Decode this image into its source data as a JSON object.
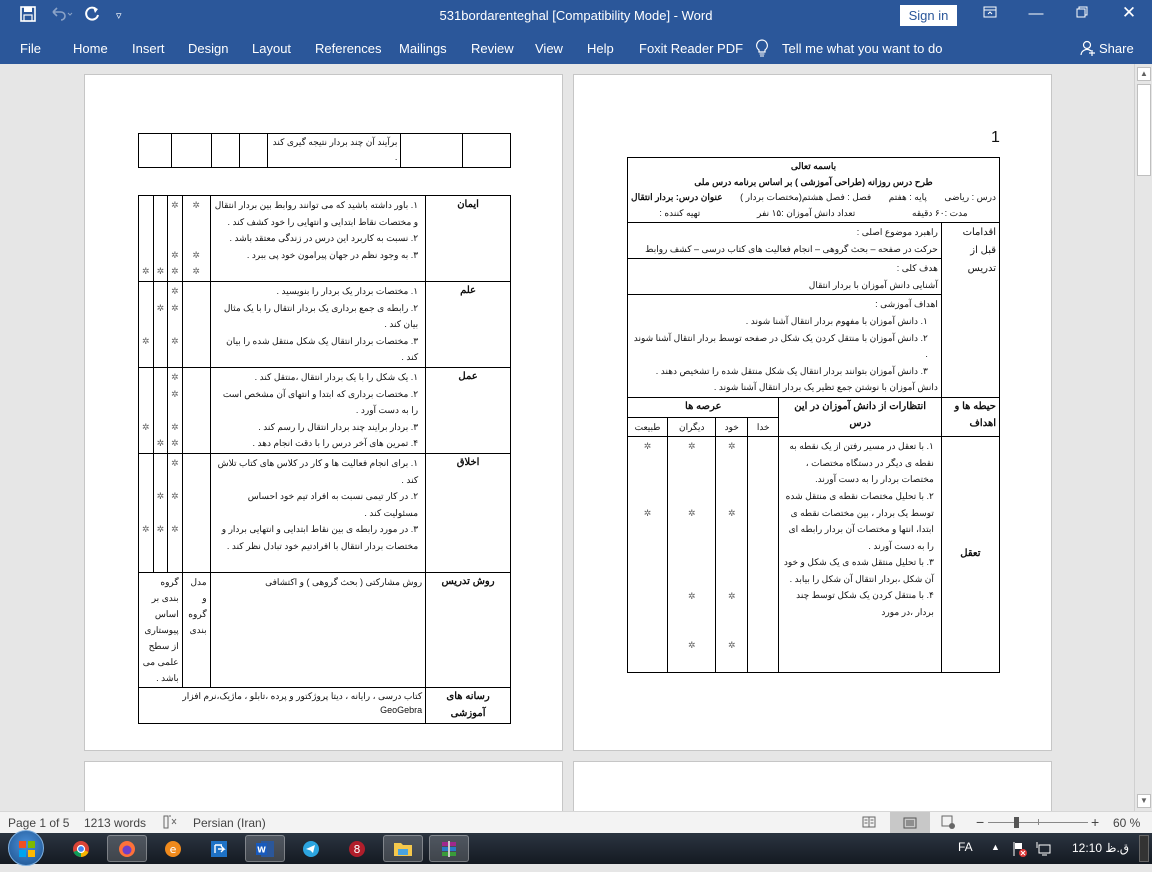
{
  "window": {
    "title": "531bordarenteghal [Compatibility Mode]  -  Word",
    "sign_in": "Sign in",
    "qat": {
      "save": "save-icon",
      "undo": "undo-icon",
      "redo": "redo-icon",
      "customize": "customize-qat-icon"
    }
  },
  "ribbon": {
    "tabs": [
      "File",
      "Home",
      "Insert",
      "Design",
      "Layout",
      "References",
      "Mailings",
      "Review",
      "View",
      "Help",
      "Foxit Reader PDF"
    ],
    "tell_me": "Tell me what you want to do",
    "share": "Share"
  },
  "page1": {
    "page_number": "1",
    "header": {
      "line1": "باسمه تعالی",
      "line2": "طرح درس روزانه (طراحی آموزشی ) بر اساس برنامه درس ملی",
      "subject": "درس : ریاضی",
      "grade": "پایه : هفتم",
      "chapter": "فصل : فصل هشتم(مختصات بردار )",
      "lesson": "عنوان درس: بردار انتقال",
      "duration": "مدت :۶۰ دقیقه",
      "students": "تعداد دانش آموزان :۱۵ نفر",
      "author": "تهیه کننده :"
    },
    "pre_teaching": {
      "label": "اقدامات قبل از تدریس",
      "strategy_title": "راهبرد موضوع اصلی :",
      "strategy_text": "حرکت در صفحه – بحث گروهی – انجام فعالیت های کتاب درسی – کشف روابط",
      "general_goal_title": "هدف کلی :",
      "general_goal_text": "آشنایی دانش آموزان با بردار انتقال",
      "objectives_title": "اهداف آموزشی :",
      "objectives": [
        "۱.  دانش آموزان با مفهوم بردار انتقال آشنا شوند .",
        "۲.  دانش آموزان با منتقل کردن یک شکل در صفحه توسط بردار انتقال آشنا شوند .",
        "۳.  دانش آموزان بتوانند بردار انتقال یک شکل منتقل شده را تشخیص دهند ."
      ],
      "objective_extra": "دانش آموزان با نوشتن جمع تظیر یک بردار انتقال آشنا شوند ."
    },
    "columns": {
      "domain": "حیطه ها و اهداف",
      "expectations": "انتظارات از دانش آموزان در این درس",
      "arenas": "عرصه ها",
      "god": "خدا",
      "self": "خود",
      "others": "دیگران",
      "nature": "طبیعت"
    },
    "reasoning": {
      "label": "تعقل",
      "items": [
        "۱.  با تعقل در مسیر رفتن از یک نقطه به نقطه ی دیگر در دستگاه مختصات ، مختصات بردار را به دست آورند.",
        "۲.  با تحلیل مختصات نقطه ی منتقل شده توسط یک بردار ، بین مختصات نقطه ی ابتدا، انتها و مختصات آن بردار رابطه ای را به دست آورند .",
        "۳.  با تحلیل منتقل شده ی یک شکل و خود آن شکل ،بردار انتقال آن شکل را بیابد .",
        "۴.  با منتقل کردن یک شکل توسط چند بردار ،در مورد"
      ],
      "marks": [
        {
          "god": "",
          "self": "*",
          "others": "*",
          "nature": "*"
        },
        {
          "god": "",
          "self": "*",
          "others": "*",
          "nature": "*"
        },
        {
          "god": "",
          "self": "*",
          "others": "*",
          "nature": ""
        },
        {
          "god": "",
          "self": "*",
          "others": "*",
          "nature": ""
        }
      ]
    }
  },
  "page2": {
    "continuation": {
      "text": "برآیند آن چند بردار نتیجه گیری کند ."
    },
    "rows": [
      {
        "label": "ایمان",
        "items": [
          "۱.  باور داشته باشید که می توانند روابط بین بردار انتقال و مختصات نقاط ابتدایی و انتهایی را خود کشف کند .",
          "۲.  نسبت به کاربرد این درس در زندگی معتقد باشد .",
          "۳.  به وجود نظم در جهان پیرامون خود پی ببرد ."
        ],
        "marks": [
          {
            "god": "*",
            "self": "*",
            "others": "",
            "nature": ""
          },
          {
            "god": "*",
            "self": "*",
            "others": "",
            "nature": ""
          },
          {
            "god": "*",
            "self": "*",
            "others": "*",
            "nature": "*"
          }
        ]
      },
      {
        "label": "علم",
        "items": [
          "۱.  مختصات بردار یک بردار را بنویسید .",
          "۲.  رابطه ی جمع برداری یک بردار انتقال را با یک مثال بیان کند .",
          "۳.  مختصات بردار انتقال یک شکل منتقل شده را بیان کند ."
        ],
        "marks": [
          {
            "god": "",
            "self": "*",
            "others": "",
            "nature": ""
          },
          {
            "god": "",
            "self": "*",
            "others": "*",
            "nature": ""
          },
          {
            "god": "",
            "self": "*",
            "others": "",
            "nature": "*"
          }
        ]
      },
      {
        "label": "عمل",
        "items": [
          "۱.  یک شکل را با یک بردار انتقال ،منتقل کند .",
          "۲.  مختصات برداری که ابتدا و انتهای آن مشخص است را به دست آورد .",
          "۳.  بردار برایند چند بردار انتقال را رسم کند .",
          "۴.  تمرین های آخر درس را با دقت انجام دهد ."
        ],
        "marks": [
          {
            "god": "",
            "self": "*",
            "others": "",
            "nature": ""
          },
          {
            "god": "",
            "self": "*",
            "others": "",
            "nature": ""
          },
          {
            "god": "",
            "self": "*",
            "others": "",
            "nature": "*"
          },
          {
            "god": "",
            "self": "*",
            "others": "*",
            "nature": ""
          }
        ]
      },
      {
        "label": "اخلاق",
        "items": [
          "۱.  برای انجام فعالیت ها و کار در کلاس های کتاب تلاش کند .",
          "۲.  در کار تیمی نسبت به افراد تیم خود احساس مسئولیت کند .",
          "۳.  در مورد رابطه ی بین نقاط ابتدایی و انتهایی بردار و مختصات بردار انتقال با افرادتیم خود تبادل نظر کند ."
        ],
        "marks": [
          {
            "god": "",
            "self": "*",
            "others": "",
            "nature": ""
          },
          {
            "god": "",
            "self": "*",
            "others": "*",
            "nature": ""
          },
          {
            "god": "",
            "self": "*",
            "others": "*",
            "nature": "*"
          }
        ]
      }
    ],
    "method": {
      "label": "روش تدریس",
      "text": "روش مشارکتی ( بحث گروهی ) و اکتشافی",
      "model": "مدل و گروه بندی",
      "grouping": "گروه بندی بر اساس پیوستاری از سطح علمی می باشد ."
    },
    "media": {
      "label": "رسانه های آموزشی",
      "text": "کتاب درسی ، رایانه ، دیتا پروژکتور و پرده ،تابلو ، ماژیک،نرم افزار GeoGebra"
    }
  },
  "statusbar": {
    "page": "Page 1 of 5",
    "words": "1213 words",
    "language": "Persian (Iran)",
    "zoom_minus": "−",
    "zoom_plus": "+",
    "zoom": "60 %",
    "zoom_percent": 60
  },
  "taskbar": {
    "language": "FA",
    "time": "12:10 ق.ظ",
    "apps": [
      "start",
      "chrome",
      "firefox",
      "edge-like",
      "anydesk",
      "word",
      "telegram",
      "app-8",
      "file-explorer",
      "winrar"
    ]
  }
}
